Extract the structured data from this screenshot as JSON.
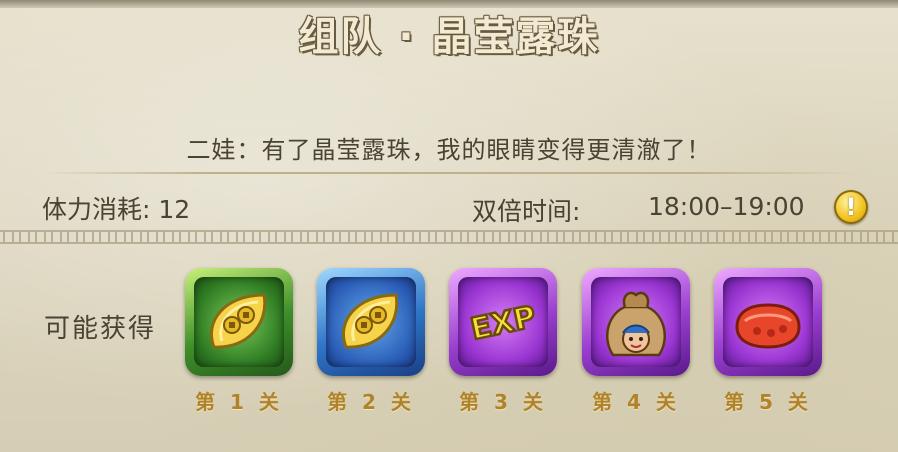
{
  "header": {
    "title": "组队 · 晶莹露珠"
  },
  "dialogue": {
    "text": "二娃：有了晶莹露珠，我的眼睛变得更清澈了！"
  },
  "stats": {
    "stamina_label": "体力消耗: 12",
    "double_time_label": "双倍时间:",
    "double_time_value": "18:00–19:00",
    "info_icon": "!"
  },
  "rewards": {
    "label": "可能获得",
    "items": [
      {
        "icon": "gold-coin-leaf-icon",
        "frame_color": "#3e8f2a",
        "stage_label": "第 1 关"
      },
      {
        "icon": "gold-coin-leaf-icon",
        "frame_color": "#2e74c7",
        "stage_label": "第 2 关"
      },
      {
        "icon": "exp-icon",
        "icon_text": "EXP",
        "frame_color": "#9a3fd0",
        "stage_label": "第 3 关"
      },
      {
        "icon": "gourd-doll-bag-icon",
        "frame_color": "#9a3fd0",
        "stage_label": "第 4 关"
      },
      {
        "icon": "red-gem-icon",
        "frame_color": "#9a3fd0",
        "stage_label": "第 5 关"
      }
    ]
  }
}
